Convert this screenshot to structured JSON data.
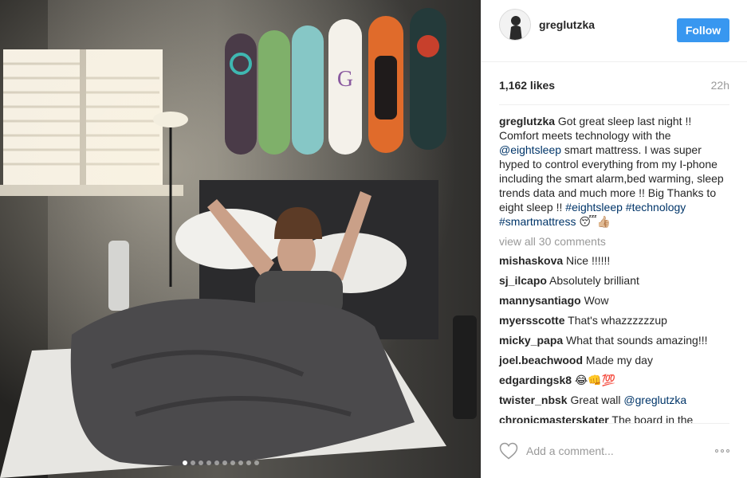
{
  "post": {
    "username": "greglutzka",
    "follow_label": "Follow",
    "likes": "1,162 likes",
    "time": "22h",
    "caption": {
      "username": "greglutzka",
      "text_1": " Got great sleep last night !! Comfort meets technology with the ",
      "mention": "@eightsleep",
      "text_2": " smart mattress. I was super hyped to control everything from my I-phone including the smart alarm,bed warming, sleep trends data and much more !! Big Thanks to eight sleep !! ",
      "tag_1": "#eightsleep",
      "tag_2": "#technology",
      "tag_3": "#smartmattress",
      "emoji": "😴👍🏼"
    },
    "view_all": "view all 30 comments",
    "comments": [
      {
        "user": "mishaskova",
        "text": " Nice !!!!!!"
      },
      {
        "user": "sj_ilcapo",
        "text": " Absolutely brilliant"
      },
      {
        "user": "mannysantiago",
        "text": " Wow"
      },
      {
        "user": "myersscotte",
        "text": " That's whazzzzzzup"
      },
      {
        "user": "micky_papa",
        "text": " What that sounds amazing!!!"
      },
      {
        "user": "joel.beachwood",
        "text": " Made my day"
      },
      {
        "user": "edgardingsk8",
        "text": " 😂👊💯"
      },
      {
        "user": "twister_nbsk",
        "text": " Great wall ",
        "mention": "@greglutzka"
      },
      {
        "user": "chronicmasterskater",
        "text": " The board in the"
      }
    ],
    "add_comment_placeholder": "Add a comment...",
    "carousel": {
      "count": 10,
      "active_index": 0
    }
  },
  "colors": {
    "accent": "#3897f0",
    "link": "#003569",
    "muted": "#999999"
  },
  "icons": [
    "heart-icon",
    "more-options-icon"
  ]
}
